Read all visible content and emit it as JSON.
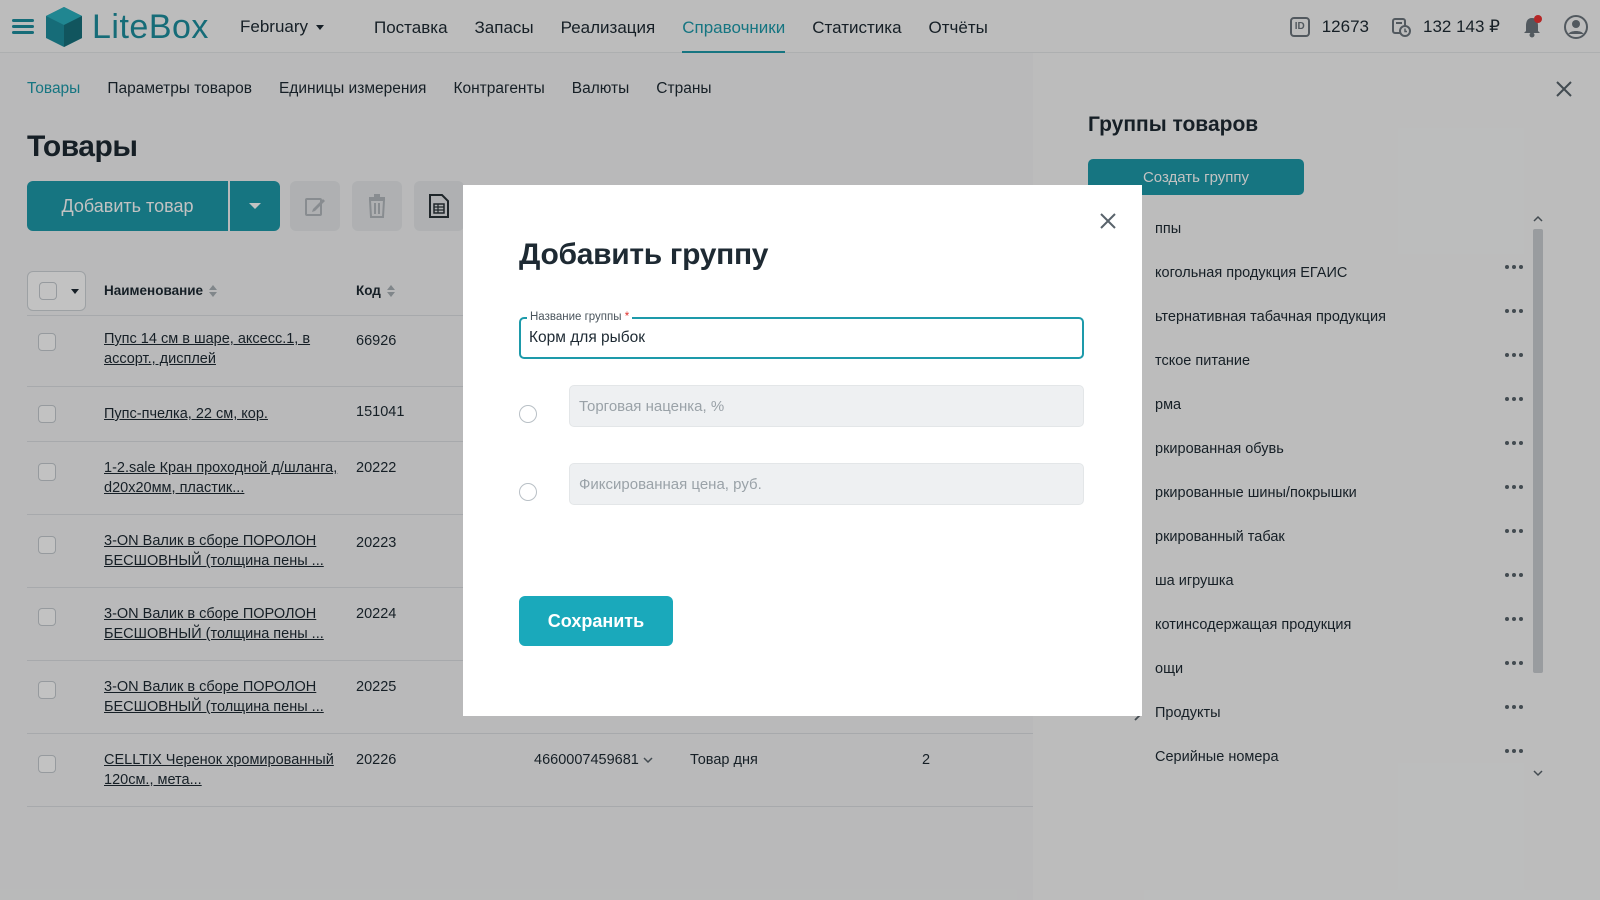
{
  "header": {
    "logo_text": "LiteBox",
    "month": "February",
    "nav": [
      "Поставка",
      "Запасы",
      "Реализация",
      "Справочники",
      "Статистика",
      "Отчёты"
    ],
    "active_nav": 3,
    "id_badge_text": "ID",
    "user_id": "12673",
    "balance": "132 143 ₽"
  },
  "subnav": {
    "items": [
      "Товары",
      "Параметры товаров",
      "Единицы измерения",
      "Контрагенты",
      "Валюты",
      "Страны"
    ],
    "active": 0
  },
  "page": {
    "title": "Товары",
    "add_button": "Добавить товар"
  },
  "table": {
    "columns": {
      "name": "Наименование",
      "code": "Код"
    },
    "rows": [
      {
        "name": "Пупс 14 см в шаре, аксесс.1, в ассорт., дисплей",
        "code": "66926",
        "barcode": "",
        "group": "",
        "qty": ""
      },
      {
        "name": "Пупс-пчелка, 22 см, кор.",
        "code": "151041",
        "barcode": "",
        "group": "",
        "qty": ""
      },
      {
        "name": "1-2.sale Кран проходной д/шланга, d20x20мм, пластик...",
        "code": "20222",
        "barcode": "",
        "group": "",
        "qty": ""
      },
      {
        "name": "3-ON Валик в сборе ПОРОЛОН БЕСШОВНЫЙ (толщина пены ...",
        "code": "20223",
        "barcode": "",
        "group": "",
        "qty": ""
      },
      {
        "name": "3-ON Валик в сборе ПОРОЛОН БЕСШОВНЫЙ (толщина пены ...",
        "code": "20224",
        "barcode": "",
        "group": "",
        "qty": ""
      },
      {
        "name": "3-ON Валик в сборе ПОРОЛОН БЕСШОВНЫЙ (толщина пены ...",
        "code": "20225",
        "barcode": "",
        "group": "",
        "qty": ""
      },
      {
        "name": "CELLTIX Черенок хромированный 120см., мета...",
        "code": "20226",
        "barcode": "4660007459681",
        "group": "Товар дня",
        "qty": "2"
      }
    ]
  },
  "side_panel": {
    "title": "Группы товаров",
    "create_button": "Создать группу",
    "groups": [
      "ппы",
      "когольная продукция ЕГАИС",
      "ьтернативная табачная продукция",
      "тское питание",
      "рма",
      "ркированная обувь",
      "ркированные шины/покрышки",
      "ркированный табак",
      "ша игрушка",
      "котинсодержащая продукция",
      "ощи",
      "Продукты",
      "Серийные номера"
    ]
  },
  "modal": {
    "title": "Добавить группу",
    "group_name_label": "Название группы",
    "required_mark": "*",
    "group_name_value": "Корм для рыбок",
    "markup_placeholder": "Торговая наценка, %",
    "fixed_price_placeholder": "Фиксированная цена, руб.",
    "save_button": "Сохранить"
  },
  "colors": {
    "accent": "#1d9aaa",
    "save_button": "#1aa9bb",
    "notification_dot": "#e33333"
  }
}
